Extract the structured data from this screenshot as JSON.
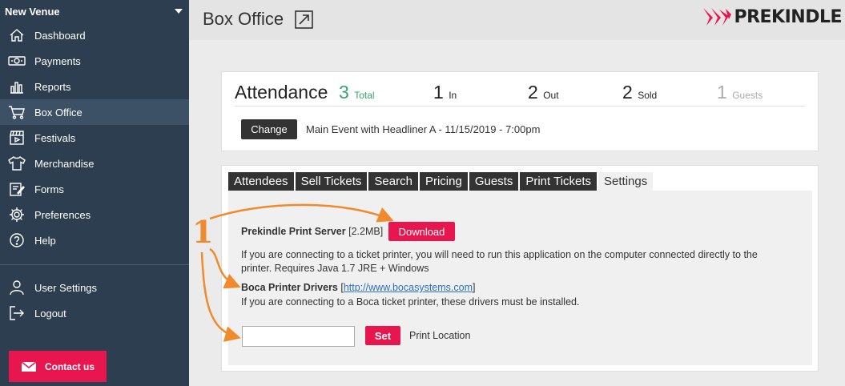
{
  "sidebar": {
    "venue": "New Venue",
    "items": [
      {
        "label": "Dashboard",
        "icon": "home-icon"
      },
      {
        "label": "Payments",
        "icon": "cash-icon"
      },
      {
        "label": "Reports",
        "icon": "bar-chart-icon"
      },
      {
        "label": "Box Office",
        "icon": "cart-icon",
        "active": true
      },
      {
        "label": "Festivals",
        "icon": "clapperboard-icon"
      },
      {
        "label": "Merchandise",
        "icon": "tshirt-icon"
      },
      {
        "label": "Forms",
        "icon": "form-icon"
      },
      {
        "label": "Preferences",
        "icon": "gear-icon"
      },
      {
        "label": "Help",
        "icon": "help-icon"
      }
    ],
    "bottom_items": [
      {
        "label": "User Settings",
        "icon": "user-icon"
      },
      {
        "label": "Logout",
        "icon": "logout-icon"
      }
    ],
    "contact": "Contact us"
  },
  "header": {
    "title": "Box Office",
    "logo": "PREKINDLE"
  },
  "attendance": {
    "title": "Attendance",
    "total_value": "3",
    "total_label": "Total",
    "in_value": "1",
    "in_label": "In",
    "out_value": "2",
    "out_label": "Out",
    "sold_value": "2",
    "sold_label": "Sold",
    "guests_value": "1",
    "guests_label": "Guests",
    "change_label": "Change",
    "event": "Main Event with Headliner A - 11/15/2019 - 7:00pm"
  },
  "tabs": [
    "Attendees",
    "Sell Tickets",
    "Search",
    "Pricing",
    "Guests",
    "Print Tickets",
    "Settings"
  ],
  "settings": {
    "print_server_label": "Prekindle Print Server",
    "print_server_size": "[2.2MB]",
    "download_label": "Download",
    "print_server_desc_1": "If you are connecting to a ticket printer, you will need to run this application on the computer connected directly to the",
    "print_server_desc_2": "printer. Requires Java 1.7 JRE + Windows",
    "boca_label": "Boca Printer Drivers",
    "boca_link": "http://www.bocasystems.com",
    "boca_desc": "If you are connecting to a Boca ticket printer, these drivers must be installed.",
    "location_value": "",
    "set_label": "Set",
    "print_location_label": "Print Location"
  },
  "annotation": {
    "marker": "1",
    "color": "#f08a2c"
  },
  "colors": {
    "sidebar_bg": "#2c3e50",
    "accent": "#e8164f",
    "total_green": "#39a36d"
  }
}
